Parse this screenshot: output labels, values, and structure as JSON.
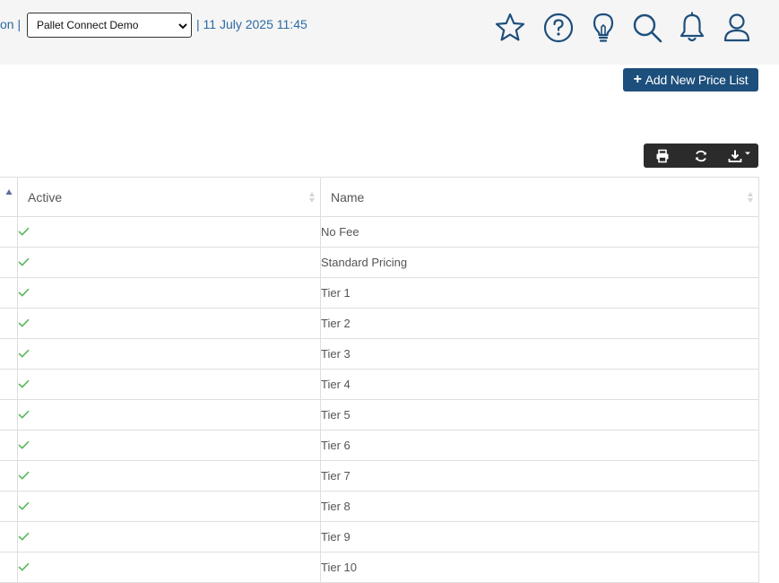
{
  "header": {
    "breadcrumb_left": "on |",
    "organization_selected": "Pallet Connect Demo",
    "date_text": "| 11 July 2025 11:45",
    "icons": [
      "star-icon",
      "help-icon",
      "lightbulb-icon",
      "search-icon",
      "bell-icon",
      "user-icon"
    ]
  },
  "actions": {
    "add_label": "Add New Price List"
  },
  "table": {
    "columns": [
      "",
      "Active",
      "Name"
    ],
    "rows": [
      {
        "active": true,
        "name": "No Fee"
      },
      {
        "active": true,
        "name": "Standard Pricing"
      },
      {
        "active": true,
        "name": "Tier 1"
      },
      {
        "active": true,
        "name": "Tier 2"
      },
      {
        "active": true,
        "name": "Tier 3"
      },
      {
        "active": true,
        "name": "Tier 4"
      },
      {
        "active": true,
        "name": "Tier 5"
      },
      {
        "active": true,
        "name": "Tier 6"
      },
      {
        "active": true,
        "name": "Tier 7"
      },
      {
        "active": true,
        "name": "Tier 8"
      },
      {
        "active": true,
        "name": "Tier 9"
      },
      {
        "active": true,
        "name": "Tier 10"
      }
    ]
  },
  "colors": {
    "accent": "#1d4f7c",
    "link": "#2a6aa3",
    "check": "#5cb85c",
    "toolbar": "#2b2b2b"
  }
}
